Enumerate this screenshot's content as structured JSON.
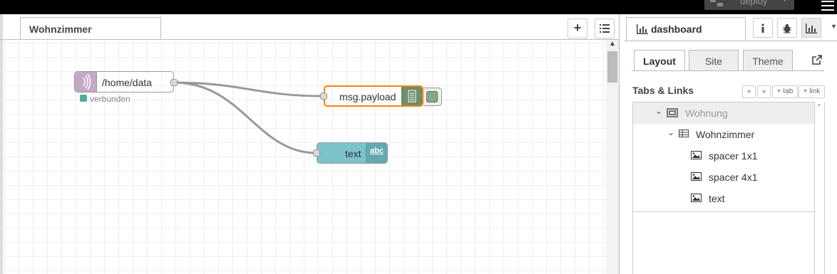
{
  "header": {
    "deploy_label": "deploy",
    "deploy_caret": "▼"
  },
  "workspace": {
    "tab_label": "Wohnzimmer",
    "add_flow_symbol": "+",
    "flow_list_symbol": "☰"
  },
  "nodes": {
    "mqtt_in": {
      "label": "/home/data",
      "status": "verbunden",
      "color": "#d7bfd9"
    },
    "debug": {
      "label": "msg.payload",
      "color": "#87a980",
      "selected_border": "#ff7f0e"
    },
    "text": {
      "label": "text",
      "icon_text": "abc",
      "color": "#7ac3cb"
    }
  },
  "sidebar": {
    "title": "dashboard",
    "buttons": [
      "info-icon",
      "bug-icon",
      "chart-icon"
    ],
    "tabs": [
      {
        "label": "Layout",
        "active": true
      },
      {
        "label": "Site",
        "active": false
      },
      {
        "label": "Theme",
        "active": false
      }
    ],
    "tabs_links_title": "Tabs & Links",
    "tool_buttons": {
      "collapse": "«",
      "expand": "»",
      "add_tab": "+ tab",
      "add_link": "+ link"
    },
    "tree": [
      {
        "label": "Wohnung",
        "level": 0,
        "type": "tab",
        "expanded": true
      },
      {
        "label": "Wohnzimmer",
        "level": 1,
        "type": "group",
        "expanded": true
      },
      {
        "label": "spacer 1x1",
        "level": 2,
        "type": "widget"
      },
      {
        "label": "spacer 4x1",
        "level": 2,
        "type": "widget"
      },
      {
        "label": "text",
        "level": 2,
        "type": "widget"
      }
    ]
  },
  "colors": {
    "topbar": "#000000",
    "wire": "#999999",
    "status_connected": "#55aa99"
  }
}
